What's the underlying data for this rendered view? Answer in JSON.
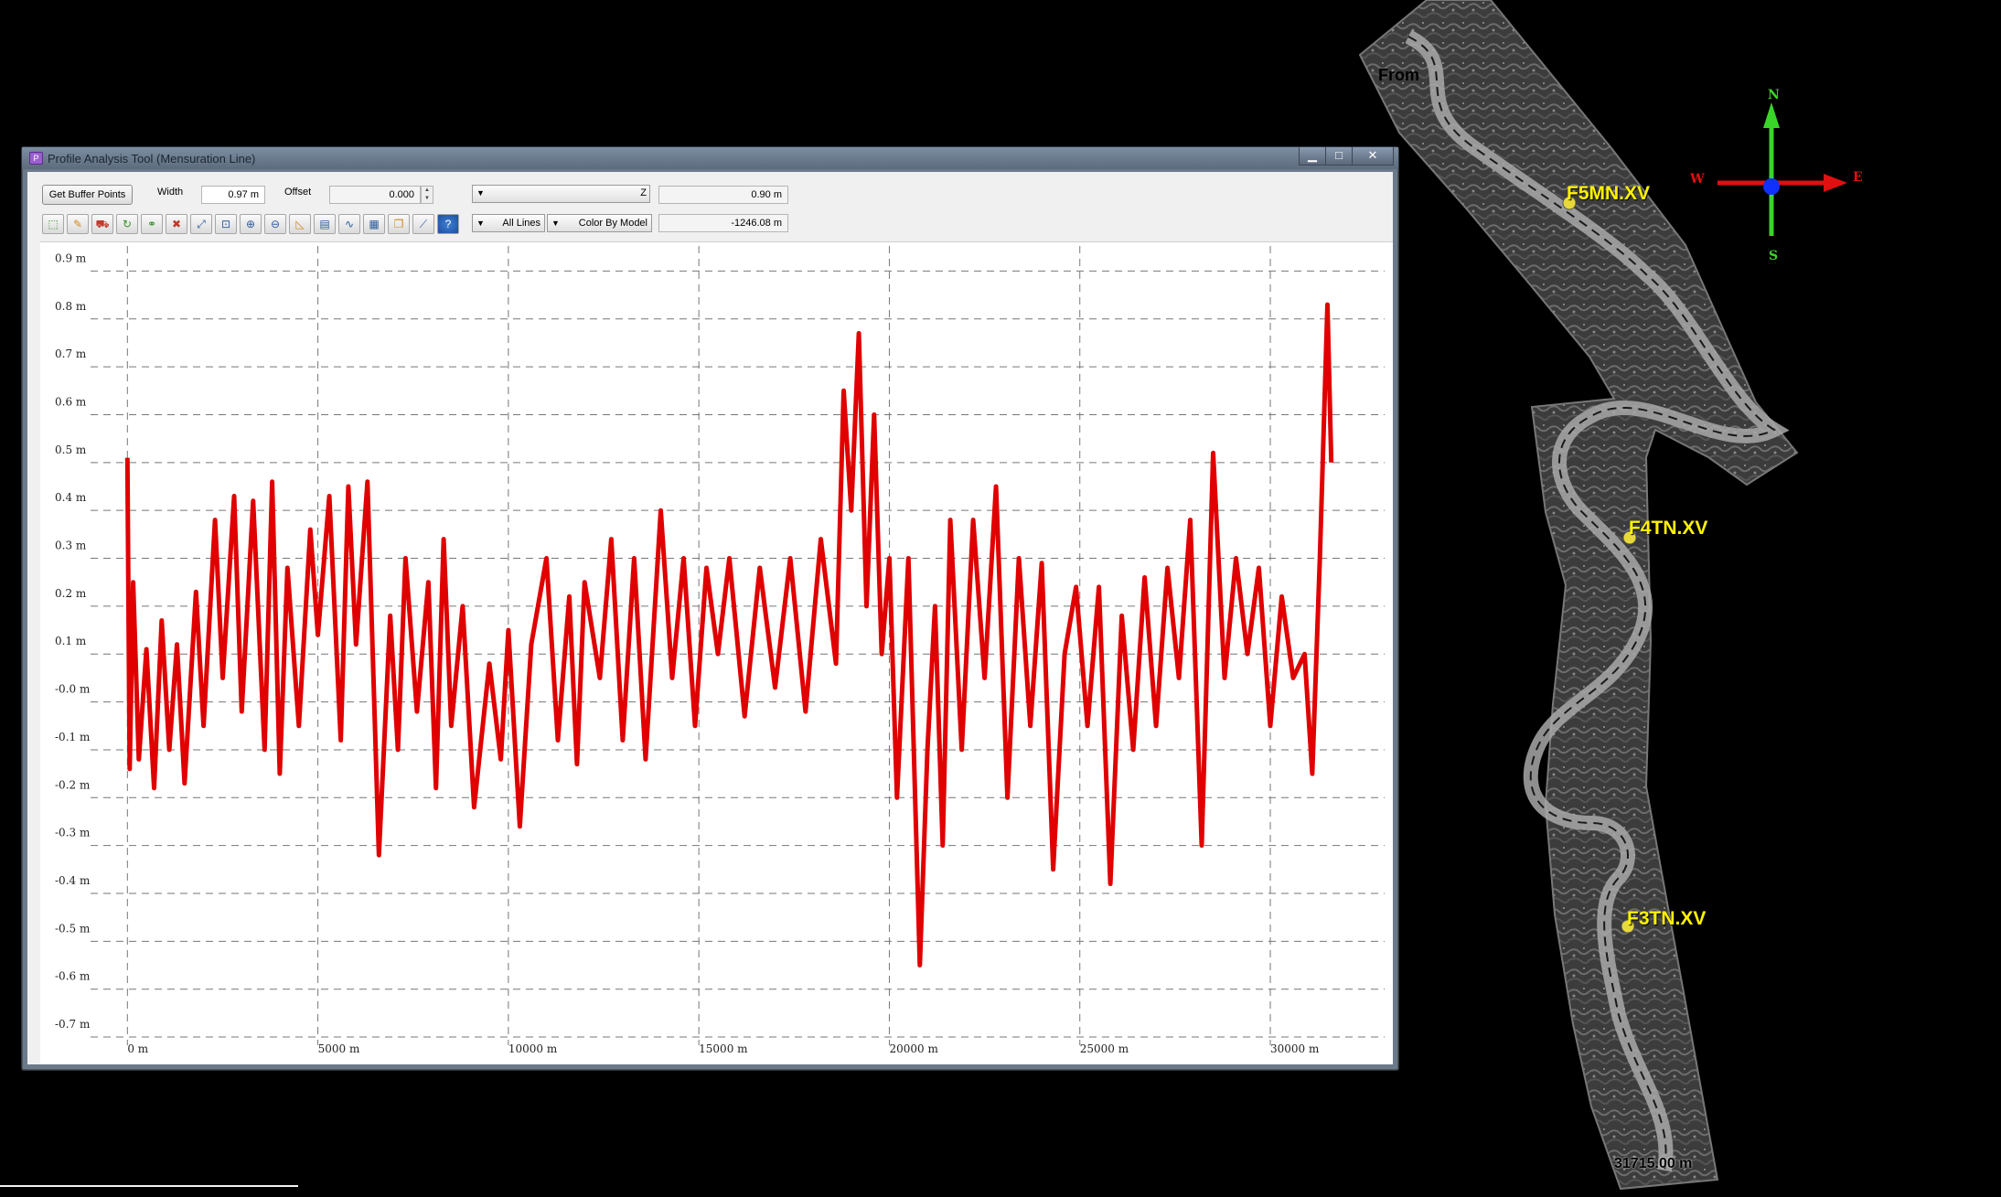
{
  "window": {
    "title": "Profile Analysis Tool (Mensuration Line)",
    "controls": {
      "minimize": "▁",
      "maximize": "□",
      "close": "✕"
    }
  },
  "toolbar": {
    "buffer_button": "Get Buffer Points",
    "width_label": "Width",
    "width_value": "0.97 m",
    "offset_label": "Offset",
    "offset_value": "0.000",
    "z_combo_label": "Z",
    "z_value": "0.90 m",
    "lines_combo": "All Lines",
    "color_combo": "Color By Model",
    "elevation_value": "-1246.08 m",
    "icons": [
      "select-icon",
      "edit-line-icon",
      "car-icon",
      "rotate-icon",
      "link-icon",
      "delete-icon",
      "fit-extent-icon",
      "zoom-region-icon",
      "zoom-in-icon",
      "zoom-out-icon",
      "measure-icon",
      "export-icon",
      "chart-icon",
      "table-icon",
      "copy-icon",
      "draw-line-icon",
      "help-icon"
    ]
  },
  "chart_data": {
    "type": "line",
    "title": "",
    "xlabel": "",
    "ylabel": "",
    "series_color": "#e00000",
    "xlim": [
      -2000,
      33000
    ],
    "ylim": [
      -0.74,
      0.96
    ],
    "x_ticks": [
      0,
      5000,
      10000,
      15000,
      20000,
      25000,
      30000
    ],
    "x_tick_labels": [
      "0 m",
      "5000 m",
      "10000 m",
      "15000 m",
      "20000 m",
      "25000 m",
      "30000 m"
    ],
    "y_ticks": [
      0.9,
      0.8,
      0.7,
      0.6,
      0.5,
      0.4,
      0.3,
      0.2,
      0.1,
      0.0,
      -0.1,
      -0.2,
      -0.3,
      -0.4,
      -0.5,
      -0.6,
      -0.7
    ],
    "y_tick_labels": [
      "0.9 m",
      "0.8 m",
      "0.7 m",
      "0.6 m",
      "0.5 m",
      "0.4 m",
      "0.3 m",
      "0.2 m",
      "0.1 m",
      "-0.0 m",
      "-0.1 m",
      "-0.2 m",
      "-0.3 m",
      "-0.4 m",
      "-0.5 m",
      "-0.6 m",
      "-0.7 m"
    ],
    "grid": true,
    "series": [
      {
        "x": [
          0,
          60,
          150,
          300,
          500,
          700,
          900,
          1100,
          1300,
          1500,
          1800,
          2000,
          2300,
          2500,
          2800,
          3000,
          3300,
          3600,
          3800,
          4000,
          4200,
          4500,
          4800,
          5000,
          5300,
          5600,
          5800,
          6000,
          6300,
          6600,
          6900,
          7100,
          7300,
          7600,
          7900,
          8100,
          8300,
          8500,
          8800,
          9100,
          9500,
          9800,
          10000,
          10300,
          10600,
          11000,
          11300,
          11600,
          11800,
          12000,
          12400,
          12700,
          13000,
          13300,
          13600,
          14000,
          14300,
          14600,
          14900,
          15200,
          15500,
          15800,
          16200,
          16600,
          17000,
          17400,
          17800,
          18200,
          18600,
          18800,
          19000,
          19200,
          19400,
          19600,
          19800,
          20000,
          20200,
          20500,
          20800,
          21000,
          21200,
          21400,
          21600,
          21900,
          22200,
          22500,
          22800,
          23100,
          23400,
          23700,
          24000,
          24300,
          24600,
          24900,
          25200,
          25500,
          25800,
          26100,
          26400,
          26700,
          27000,
          27300,
          27600,
          27900,
          28200,
          28500,
          28800,
          29100,
          29400,
          29700,
          30000,
          30300,
          30600,
          30900,
          31100,
          31300,
          31500,
          31600
        ],
        "y": [
          0.51,
          -0.14,
          0.25,
          -0.12,
          0.11,
          -0.18,
          0.17,
          -0.1,
          0.12,
          -0.17,
          0.23,
          -0.05,
          0.38,
          0.05,
          0.43,
          -0.02,
          0.42,
          -0.1,
          0.46,
          -0.15,
          0.28,
          -0.05,
          0.36,
          0.14,
          0.43,
          -0.08,
          0.45,
          0.12,
          0.46,
          -0.32,
          0.18,
          -0.1,
          0.3,
          -0.02,
          0.25,
          -0.18,
          0.34,
          -0.05,
          0.2,
          -0.22,
          0.08,
          -0.12,
          0.15,
          -0.26,
          0.12,
          0.3,
          -0.08,
          0.22,
          -0.13,
          0.25,
          0.05,
          0.34,
          -0.08,
          0.3,
          -0.12,
          0.4,
          0.05,
          0.3,
          -0.05,
          0.28,
          0.1,
          0.3,
          -0.03,
          0.28,
          0.03,
          0.3,
          -0.02,
          0.34,
          0.08,
          0.65,
          0.4,
          0.77,
          0.2,
          0.6,
          0.1,
          0.3,
          -0.2,
          0.3,
          -0.55,
          -0.1,
          0.2,
          -0.3,
          0.38,
          -0.1,
          0.38,
          0.05,
          0.45,
          -0.2,
          0.3,
          -0.05,
          0.29,
          -0.35,
          0.1,
          0.24,
          -0.05,
          0.24,
          -0.38,
          0.18,
          -0.1,
          0.26,
          -0.05,
          0.28,
          0.05,
          0.38,
          -0.3,
          0.52,
          0.05,
          0.3,
          0.1,
          0.28,
          -0.05,
          0.22,
          0.05,
          0.1,
          -0.15,
          0.3,
          0.83,
          0.5
        ]
      }
    ]
  },
  "map": {
    "from_label": "From",
    "station_labels": [
      "F5MN.XV",
      "F4TN.XV",
      "F3TN.XV"
    ],
    "distance_label": "31715.00 m",
    "compass": {
      "north": "N",
      "south": "S",
      "east": "E",
      "west": "W"
    }
  }
}
